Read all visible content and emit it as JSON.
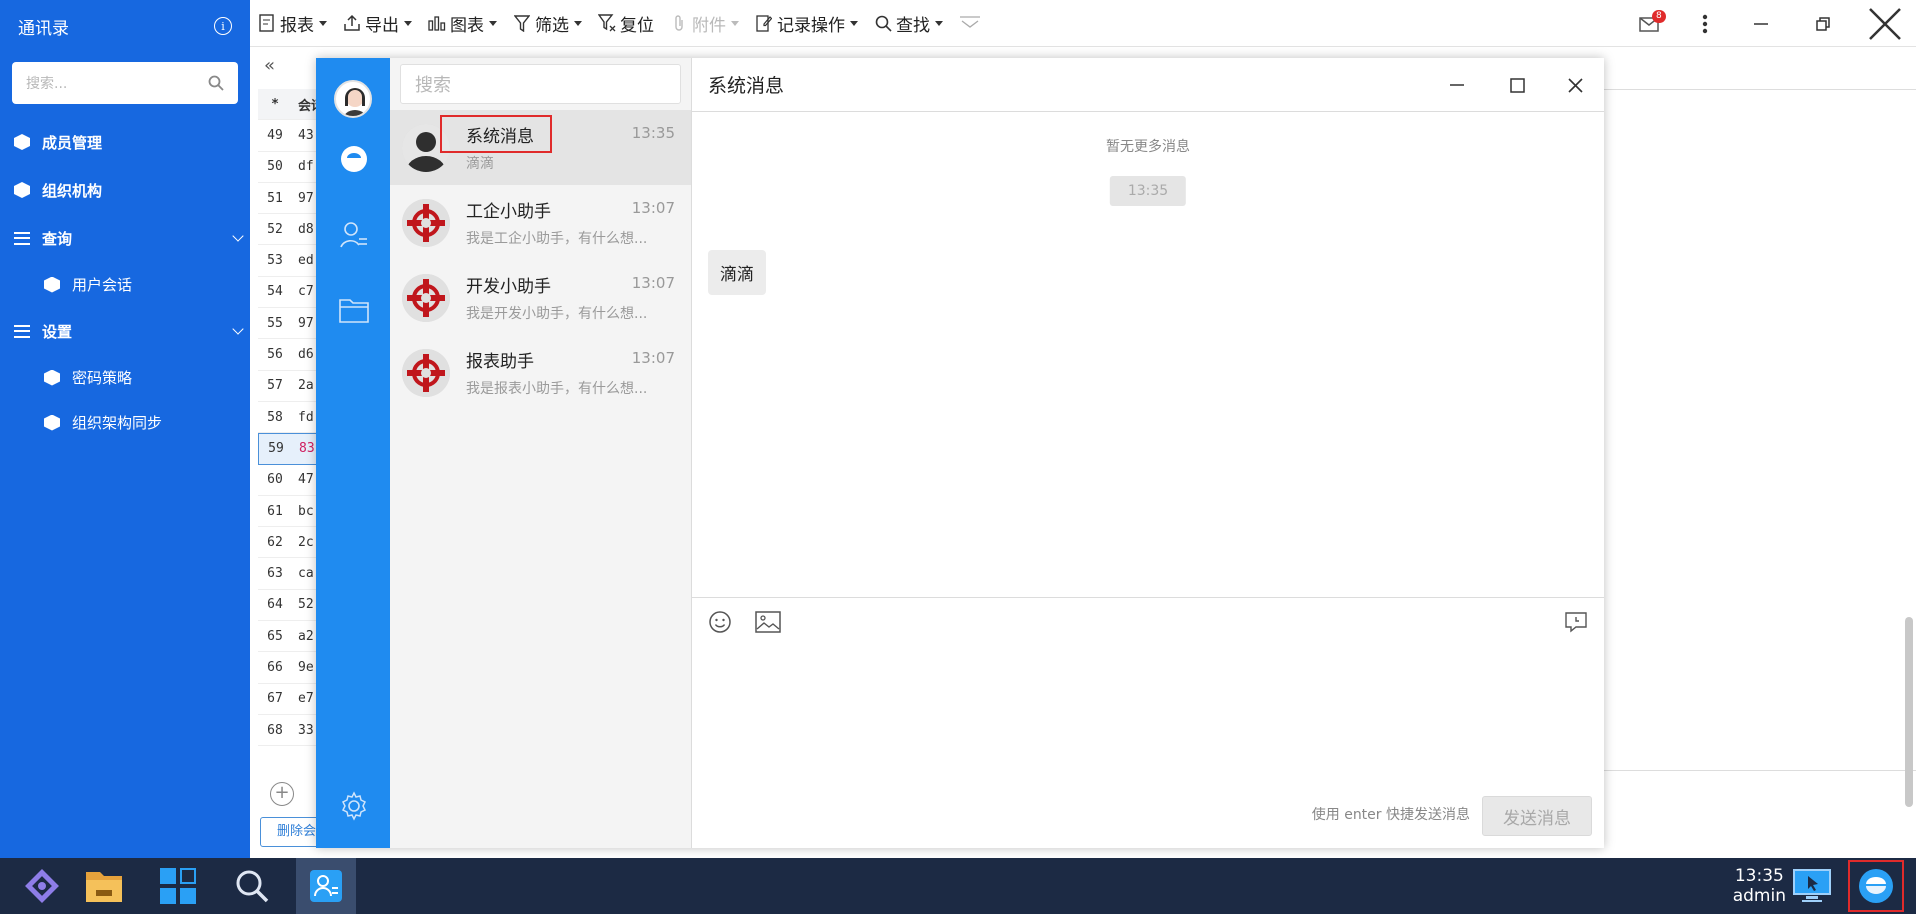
{
  "sidebar": {
    "title": "通讯录",
    "search_placeholder": "搜索...",
    "items": [
      {
        "label": "成员管理"
      },
      {
        "label": "组织机构"
      },
      {
        "label": "查询"
      },
      {
        "label": "用户会话"
      },
      {
        "label": "设置"
      },
      {
        "label": "密码策略"
      },
      {
        "label": "组织架构同步"
      }
    ]
  },
  "toolbar": {
    "report": "报表",
    "export": "导出",
    "chart": "图表",
    "filter": "筛选",
    "reset": "复位",
    "attachment": "附件",
    "record_ops": "记录操作",
    "find": "查找",
    "mail_badge": "8"
  },
  "grid": {
    "header_star": "*",
    "header_col": "会话",
    "rows": [
      {
        "n": "49",
        "v": "43"
      },
      {
        "n": "50",
        "v": "df"
      },
      {
        "n": "51",
        "v": "97"
      },
      {
        "n": "52",
        "v": "d8"
      },
      {
        "n": "53",
        "v": "ed"
      },
      {
        "n": "54",
        "v": "c7"
      },
      {
        "n": "55",
        "v": "97"
      },
      {
        "n": "56",
        "v": "d6"
      },
      {
        "n": "57",
        "v": "2a"
      },
      {
        "n": "58",
        "v": "fd"
      },
      {
        "n": "59",
        "v": "83"
      },
      {
        "n": "60",
        "v": "47"
      },
      {
        "n": "61",
        "v": "bc"
      },
      {
        "n": "62",
        "v": "2c"
      },
      {
        "n": "63",
        "v": "ca"
      },
      {
        "n": "64",
        "v": "52"
      },
      {
        "n": "65",
        "v": "a2"
      },
      {
        "n": "66",
        "v": "9e"
      },
      {
        "n": "67",
        "v": "e7"
      },
      {
        "n": "68",
        "v": "33"
      }
    ],
    "selected_row": "59",
    "delete_btn": "删除会"
  },
  "chat": {
    "search_placeholder": "搜索",
    "conversations": [
      {
        "name": "系统消息",
        "time": "13:35",
        "preview": "滴滴"
      },
      {
        "name": "工企小助手",
        "time": "13:07",
        "preview": "我是工企小助手，有什么想..."
      },
      {
        "name": "开发小助手",
        "time": "13:07",
        "preview": "我是开发小助手，有什么想..."
      },
      {
        "name": "报表助手",
        "time": "13:07",
        "preview": "我是报表小助手，有什么想..."
      }
    ],
    "header_title": "系统消息",
    "no_more": "暂无更多消息",
    "timestamp": "13:35",
    "message": "滴滴",
    "hint": "使用 enter 快捷发送消息",
    "send": "发送消息"
  },
  "taskbar": {
    "time": "13:35",
    "user": "admin"
  },
  "colors": {
    "sidebar_blue": "#1768e0",
    "rail_blue": "#1f8bf0",
    "taskbar": "#1c2a44",
    "highlight_red": "#e02b2b"
  }
}
